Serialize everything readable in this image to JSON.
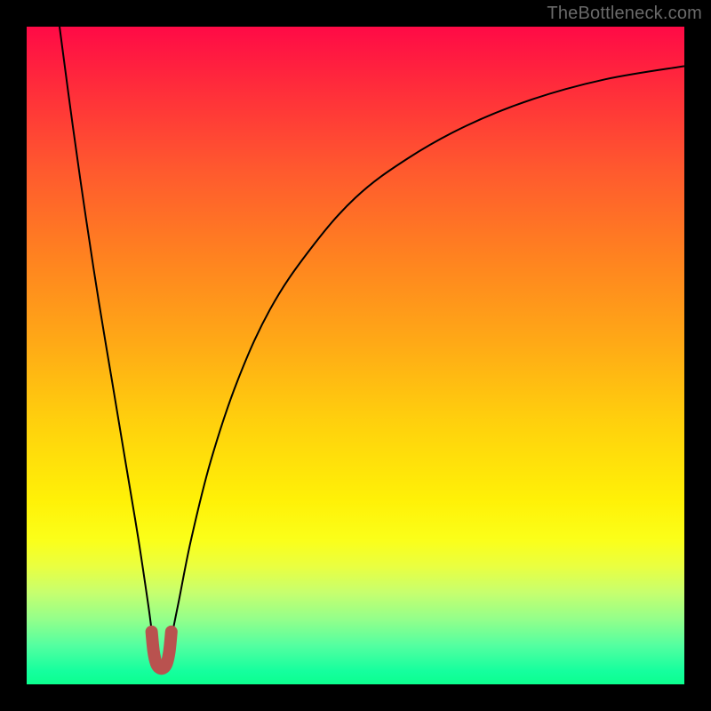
{
  "watermark": "TheBottleneck.com",
  "chart_data": {
    "type": "line",
    "title": "",
    "xlabel": "",
    "ylabel": "",
    "xlim": [
      0,
      100
    ],
    "ylim": [
      0,
      100
    ],
    "grid": false,
    "legend": false,
    "series": [
      {
        "name": "curve",
        "color": "#000000",
        "stroke_width": 2,
        "x": [
          5,
          7,
          9,
          11,
          13,
          15,
          17,
          18.5,
          19.5,
          20.5,
          21.5,
          23,
          25,
          28,
          32,
          37,
          43,
          50,
          58,
          67,
          77,
          88,
          100
        ],
        "y": [
          100,
          85,
          71,
          58,
          46,
          34,
          22,
          12,
          5,
          3,
          5,
          12,
          22,
          34,
          46,
          57,
          66,
          74,
          80,
          85,
          89,
          92,
          94
        ]
      },
      {
        "name": "minimum-marker",
        "color": "#b9524f",
        "stroke_width": 14,
        "linecap": "round",
        "x": [
          19.0,
          19.3,
          19.7,
          20.2,
          20.8,
          21.3,
          21.7,
          22.0
        ],
        "y": [
          8.0,
          5.0,
          3.2,
          2.5,
          2.5,
          3.2,
          5.0,
          8.0
        ]
      }
    ]
  }
}
